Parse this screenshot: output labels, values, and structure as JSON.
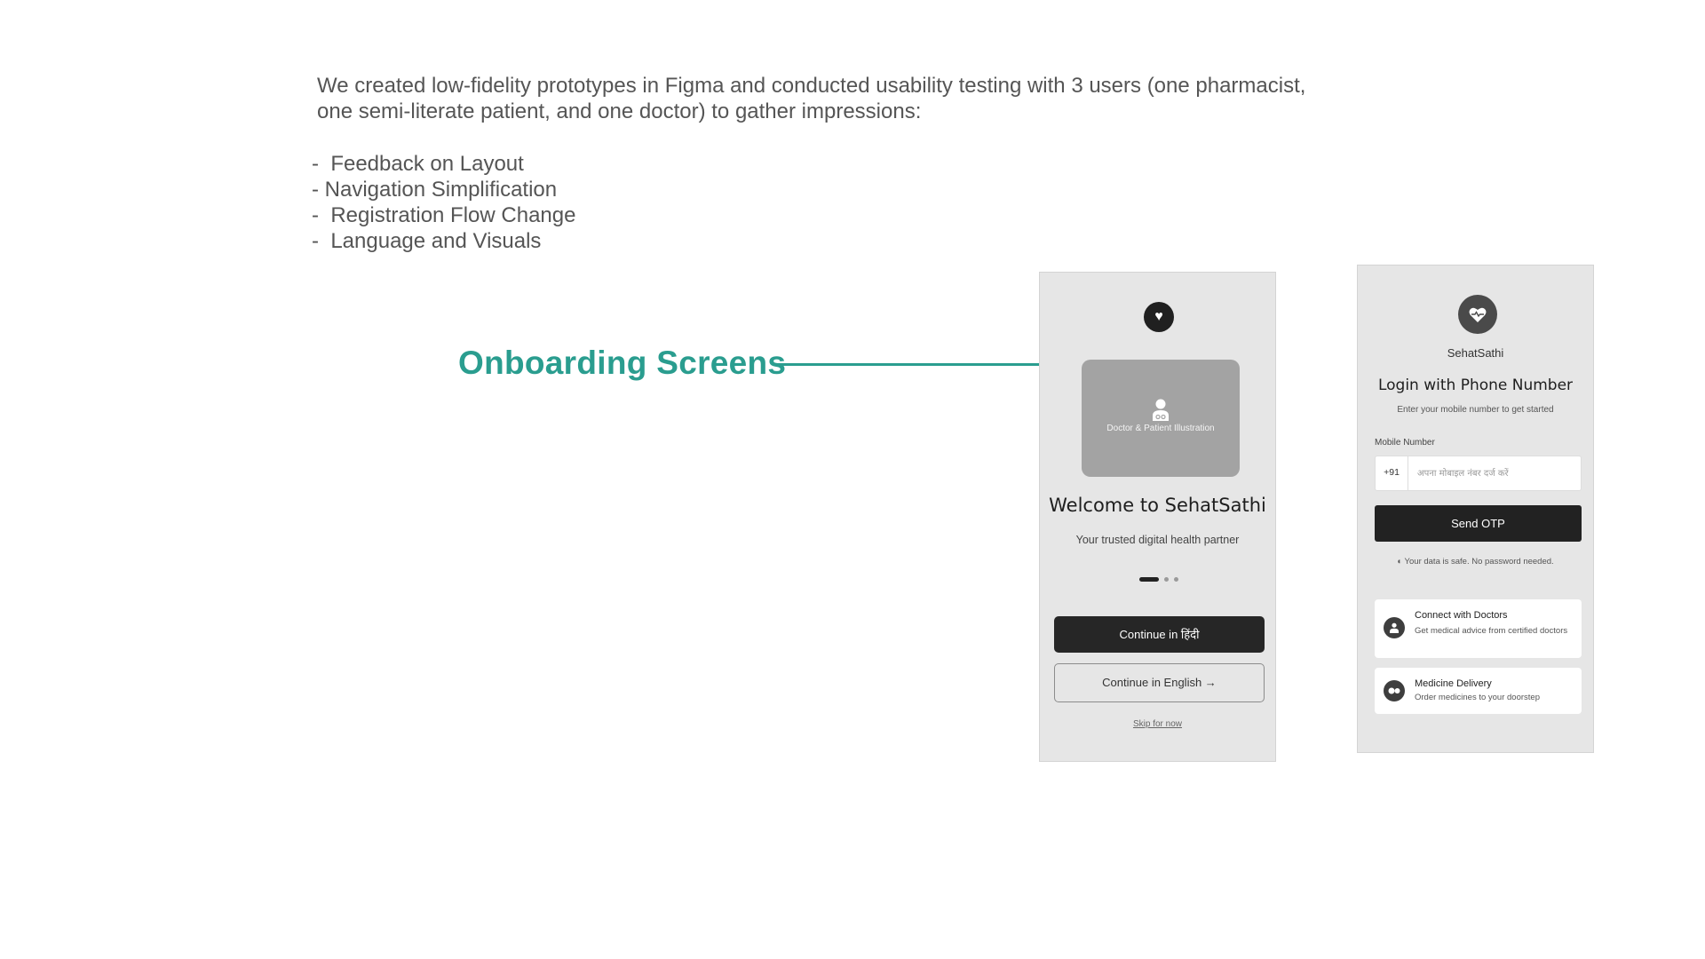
{
  "intro_text": "We created low-fidelity prototypes in Figma and conducted usability testing with 3 users (one pharmacist, one semi-literate patient, and one doctor) to gather impressions:",
  "feedback_points": [
    "-  Feedback on Layout",
    "- Navigation Simplification",
    "-  Registration Flow Change",
    "-  Language and Visuals"
  ],
  "annotation_label": "Onboarding Screens",
  "accent_color": "#2a9d8f",
  "welcome_screen": {
    "logo_icon": "heart-icon",
    "illustration_icon": "doctor-patient-icon",
    "illustration_label": "Doctor & Patient Illustration",
    "title": "Welcome to SehatSathi",
    "subtitle": "Your trusted digital health partner",
    "pager": {
      "count": 3,
      "active": 1
    },
    "primary_button": "Continue in हिंदी",
    "secondary_button": "Continue in English →",
    "skip_link": "Skip for now"
  },
  "login_screen": {
    "logo_icon": "heart-pulse-icon",
    "app_name": "SehatSathi",
    "title": "Login with Phone Number",
    "subtitle": "Enter your mobile number to get started",
    "field_label": "Mobile Number",
    "country_code": "+91",
    "input_placeholder": "अपना मोबाइल नंबर दर्ज करें",
    "send_button": "Send OTP",
    "safety_note": "◐ Your data is safe. No password needed.",
    "features": [
      {
        "icon": "doctor-icon",
        "title": "Connect with Doctors",
        "description": "Get medical advice from certified doctors"
      },
      {
        "icon": "pills-icon",
        "title": "Medicine Delivery",
        "description": "Order medicines to your doorstep"
      }
    ]
  }
}
